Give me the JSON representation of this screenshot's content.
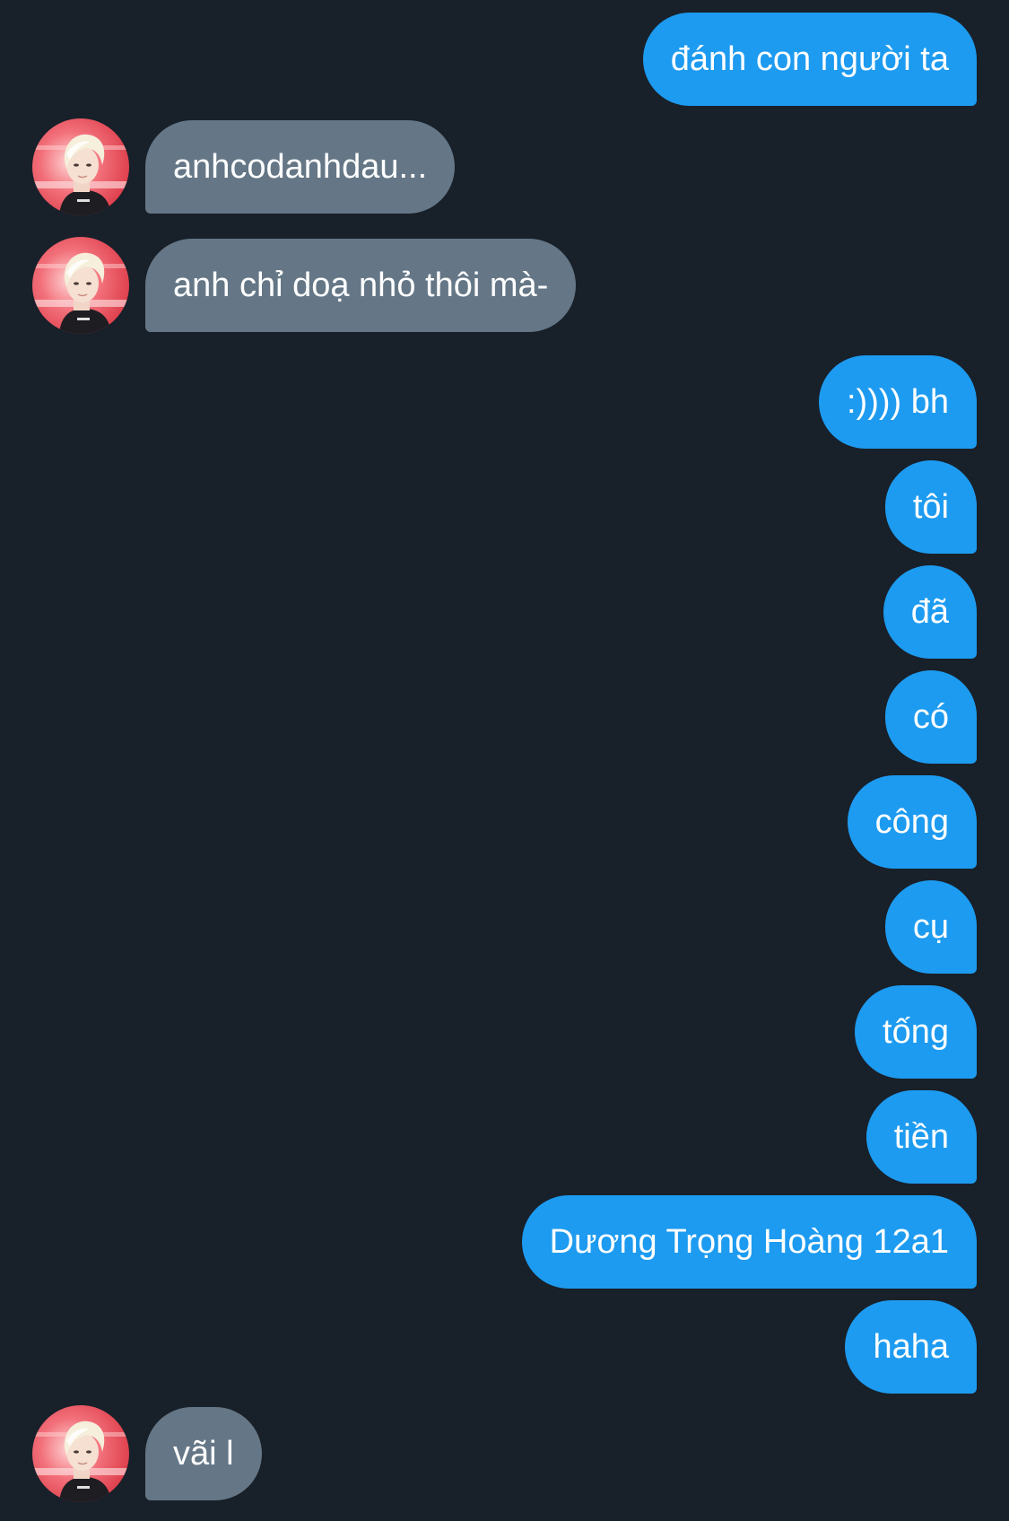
{
  "conversation": {
    "messages": [
      {
        "sender": "me",
        "text": "đánh con người ta"
      },
      {
        "sender": "other",
        "text": "anhcodanhdau..."
      },
      {
        "sender": "other",
        "text": "anh chỉ doạ nhỏ thôi mà-"
      },
      {
        "sender": "me",
        "text": ":)))) bh"
      },
      {
        "sender": "me",
        "text": "tôi"
      },
      {
        "sender": "me",
        "text": "đã"
      },
      {
        "sender": "me",
        "text": "có"
      },
      {
        "sender": "me",
        "text": "công"
      },
      {
        "sender": "me",
        "text": "cụ"
      },
      {
        "sender": "me",
        "text": "tống"
      },
      {
        "sender": "me",
        "text": "tiền"
      },
      {
        "sender": "me",
        "text": "Dương Trọng Hoàng 12a1"
      },
      {
        "sender": "me",
        "text": "haha"
      },
      {
        "sender": "other",
        "text": "vãi l"
      }
    ]
  },
  "colors": {
    "background": "#18202a",
    "outgoing_bubble": "#1d9bf0",
    "incoming_bubble": "#657786",
    "text": "#ffffff"
  }
}
